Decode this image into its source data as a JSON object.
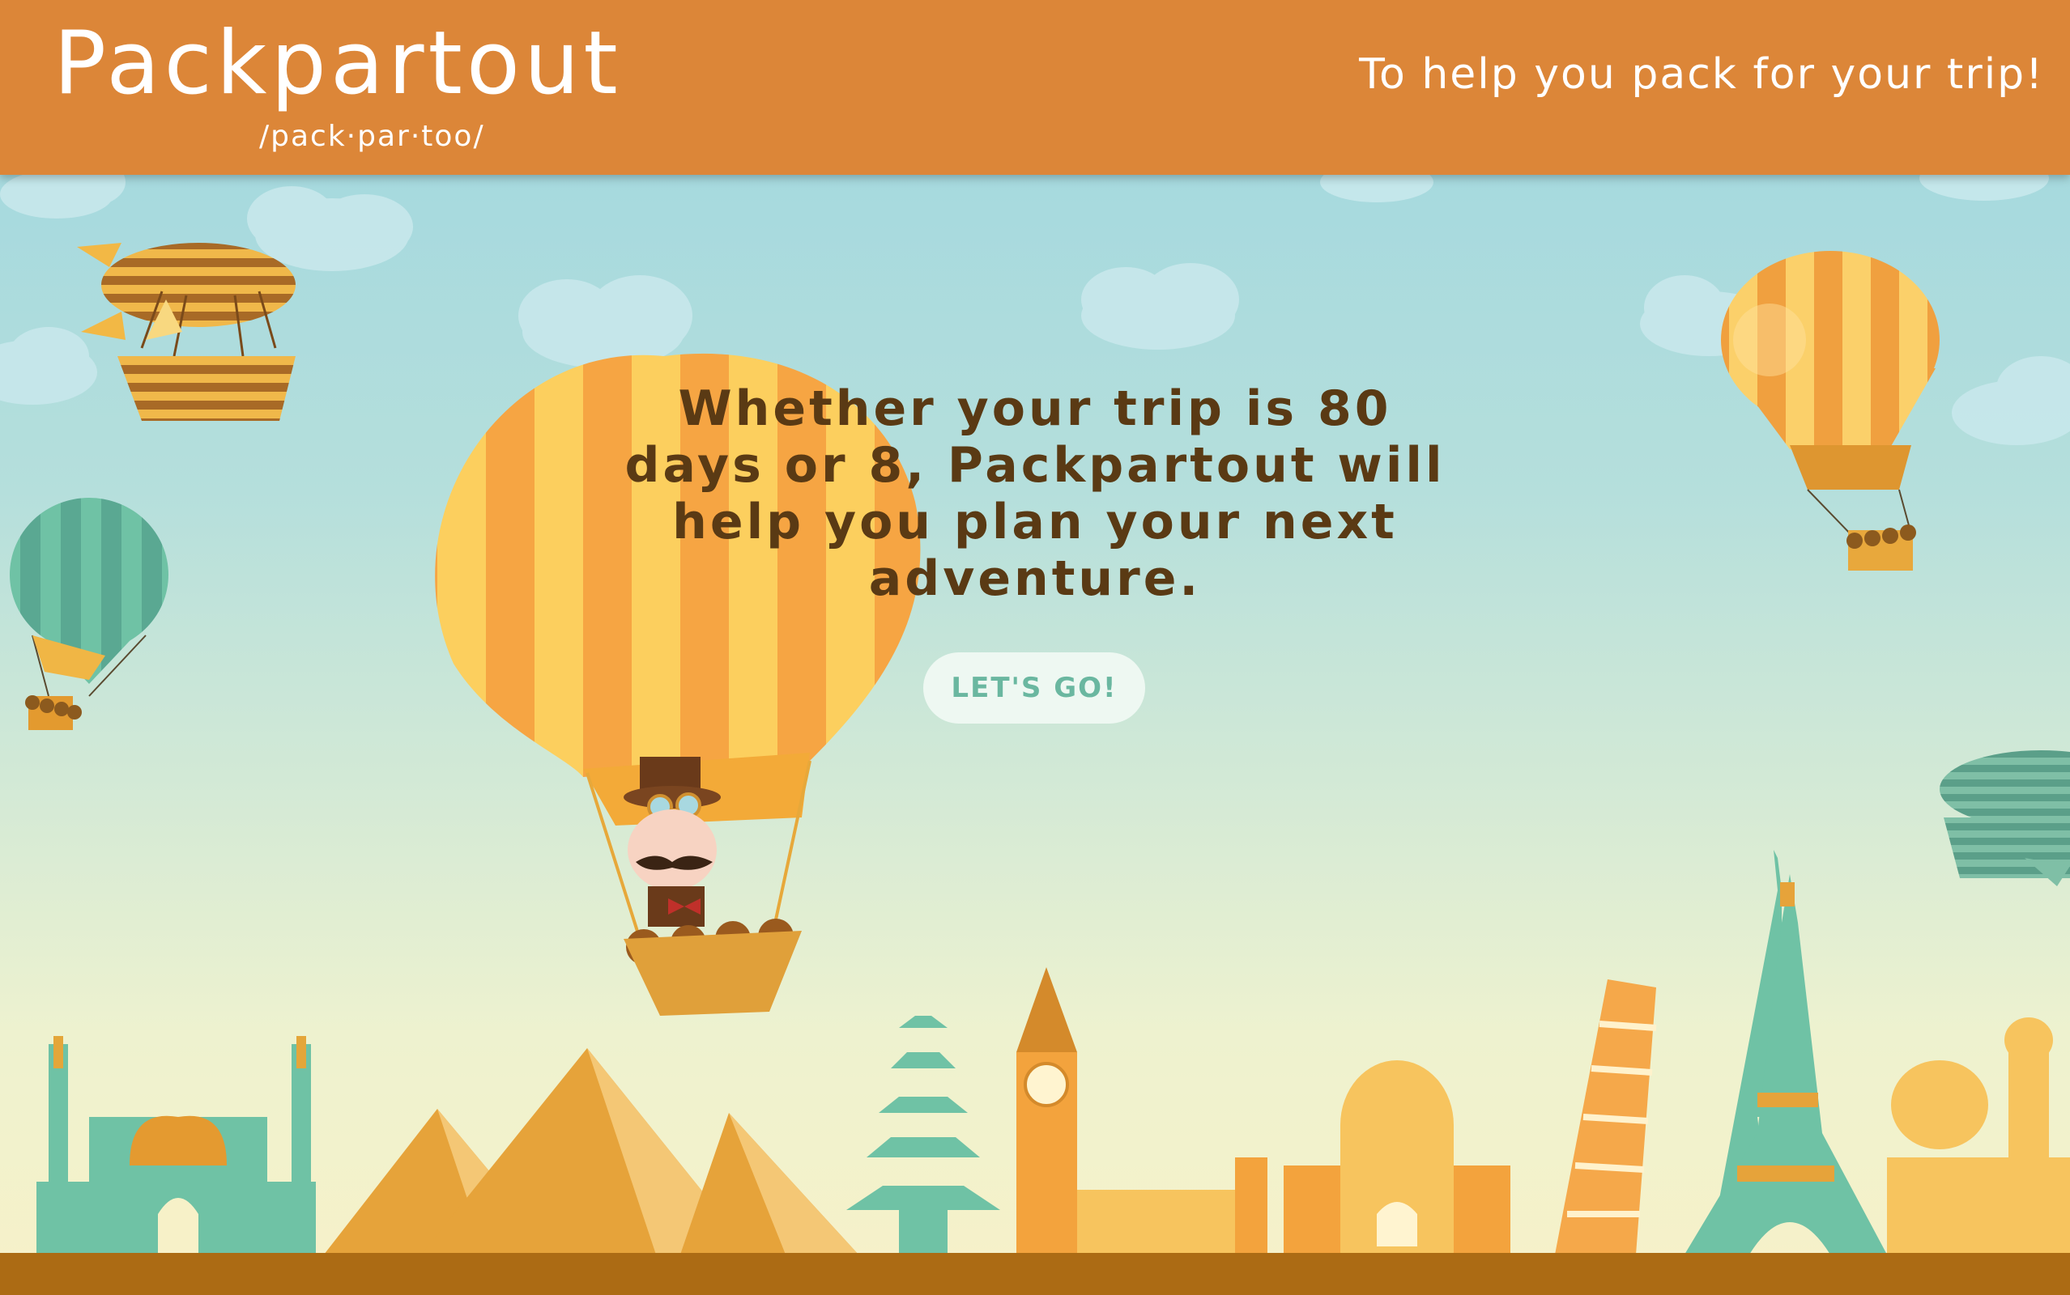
{
  "header": {
    "brand_name": "Packpartout",
    "pronunciation": "/pack·par·too/",
    "tagline": "To help you pack for your trip!"
  },
  "hero": {
    "headline": "Whether your trip is 80 days or 8, Packpartout will help you plan your next adventure.",
    "cta_label": "LET'S GO!"
  },
  "colors": {
    "header_bg": "#dc8638",
    "sky_top": "#9ed6df",
    "sky_bottom": "#f7f1c8",
    "headline_text": "#5a3a14",
    "button_bg": "#eef8f2",
    "button_text": "#6ab7a0",
    "ground": "#ac6b14"
  },
  "illustration": {
    "icons": [
      "hot-air-balloon-icon",
      "airship-icon",
      "pyramid-icon",
      "mosque-icon",
      "pagoda-icon",
      "big-ben-icon",
      "leaning-tower-icon",
      "eiffel-tower-icon",
      "taj-mahal-icon",
      "cloud-icon",
      "balloon-pilot-icon"
    ]
  }
}
